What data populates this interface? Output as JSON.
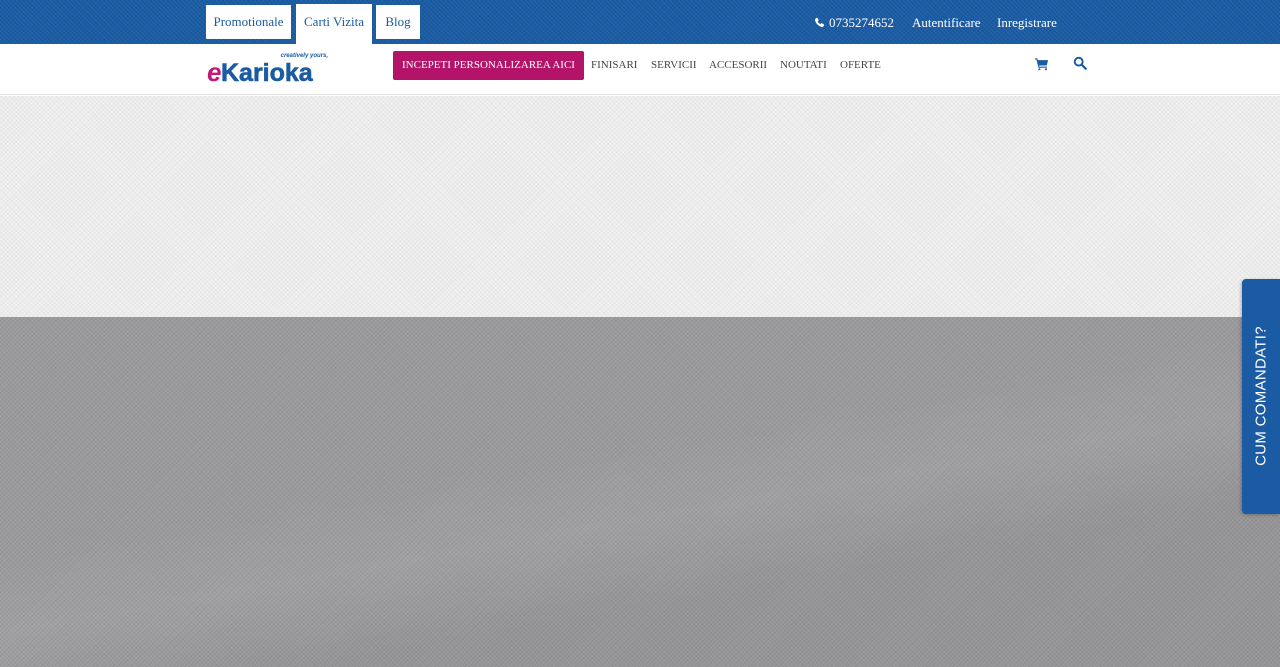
{
  "topbar": {
    "tabs": [
      {
        "label": "Promotionale",
        "active": false
      },
      {
        "label": "Carti Vizita",
        "active": true
      },
      {
        "label": "Blog",
        "active": false
      }
    ],
    "phone": "0735274652",
    "login_label": "Autentificare",
    "register_label": "Inregistrare"
  },
  "nav": {
    "logo_tagline": "creatively yours,",
    "logo_text": "eKarioka",
    "cta_label": "INCEPETI PERSONALIZAREA AICI",
    "items": [
      "FINISARI",
      "SERVICII",
      "ACCESORII",
      "NOUTATI",
      "OFERTE"
    ]
  },
  "side_tab": {
    "label": "CUM COMANDATI?"
  },
  "colors": {
    "brand_blue": "#1a5ba3",
    "cta_magenta": "#b3146a",
    "logo_pink": "#c2187a"
  },
  "icons": [
    "phone-icon",
    "cart-icon",
    "search-icon"
  ]
}
